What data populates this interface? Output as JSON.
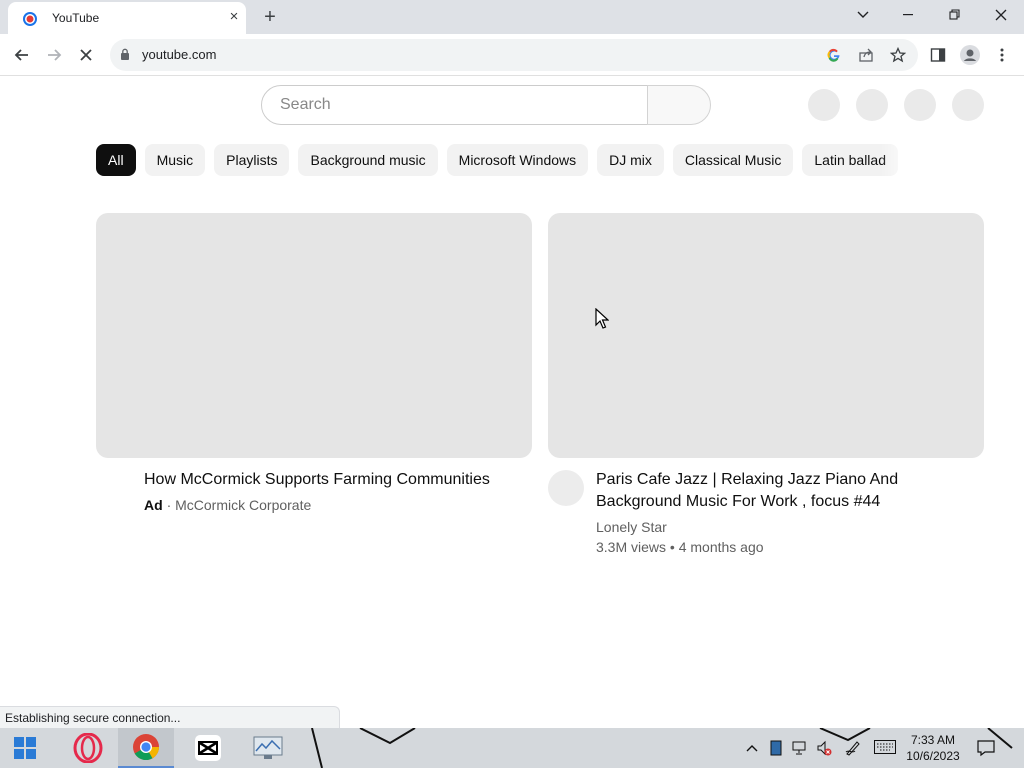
{
  "browser": {
    "tab": {
      "title": "YouTube",
      "close": "×"
    },
    "new_tab": "+",
    "url": "youtube.com"
  },
  "youtube": {
    "search": {
      "placeholder": "Search"
    },
    "chips": [
      {
        "label": "All",
        "active": true
      },
      {
        "label": "Music"
      },
      {
        "label": "Playlists"
      },
      {
        "label": "Background music"
      },
      {
        "label": "Microsoft Windows"
      },
      {
        "label": "DJ mix"
      },
      {
        "label": "Classical Music"
      },
      {
        "label": "Latin ballad"
      }
    ],
    "videos": [
      {
        "title": "How McCormick Supports Farming Communities",
        "badge": "Ad",
        "separator": "·",
        "channel": "McCormick Corporate"
      },
      {
        "title": "Paris Cafe Jazz | Relaxing Jazz Piano And Background Music For Work , focus #44",
        "channel": "Lonely Star",
        "stats": "3.3M views • 4 months ago"
      }
    ]
  },
  "status": {
    "text": "Establishing secure connection..."
  },
  "taskbar": {
    "time": "7:33 AM",
    "date": "10/6/2023"
  },
  "colors": {
    "accent": "#0f0f0f",
    "chip_bg": "#f2f2f2",
    "placeholder_bg": "#e5e5e5"
  }
}
